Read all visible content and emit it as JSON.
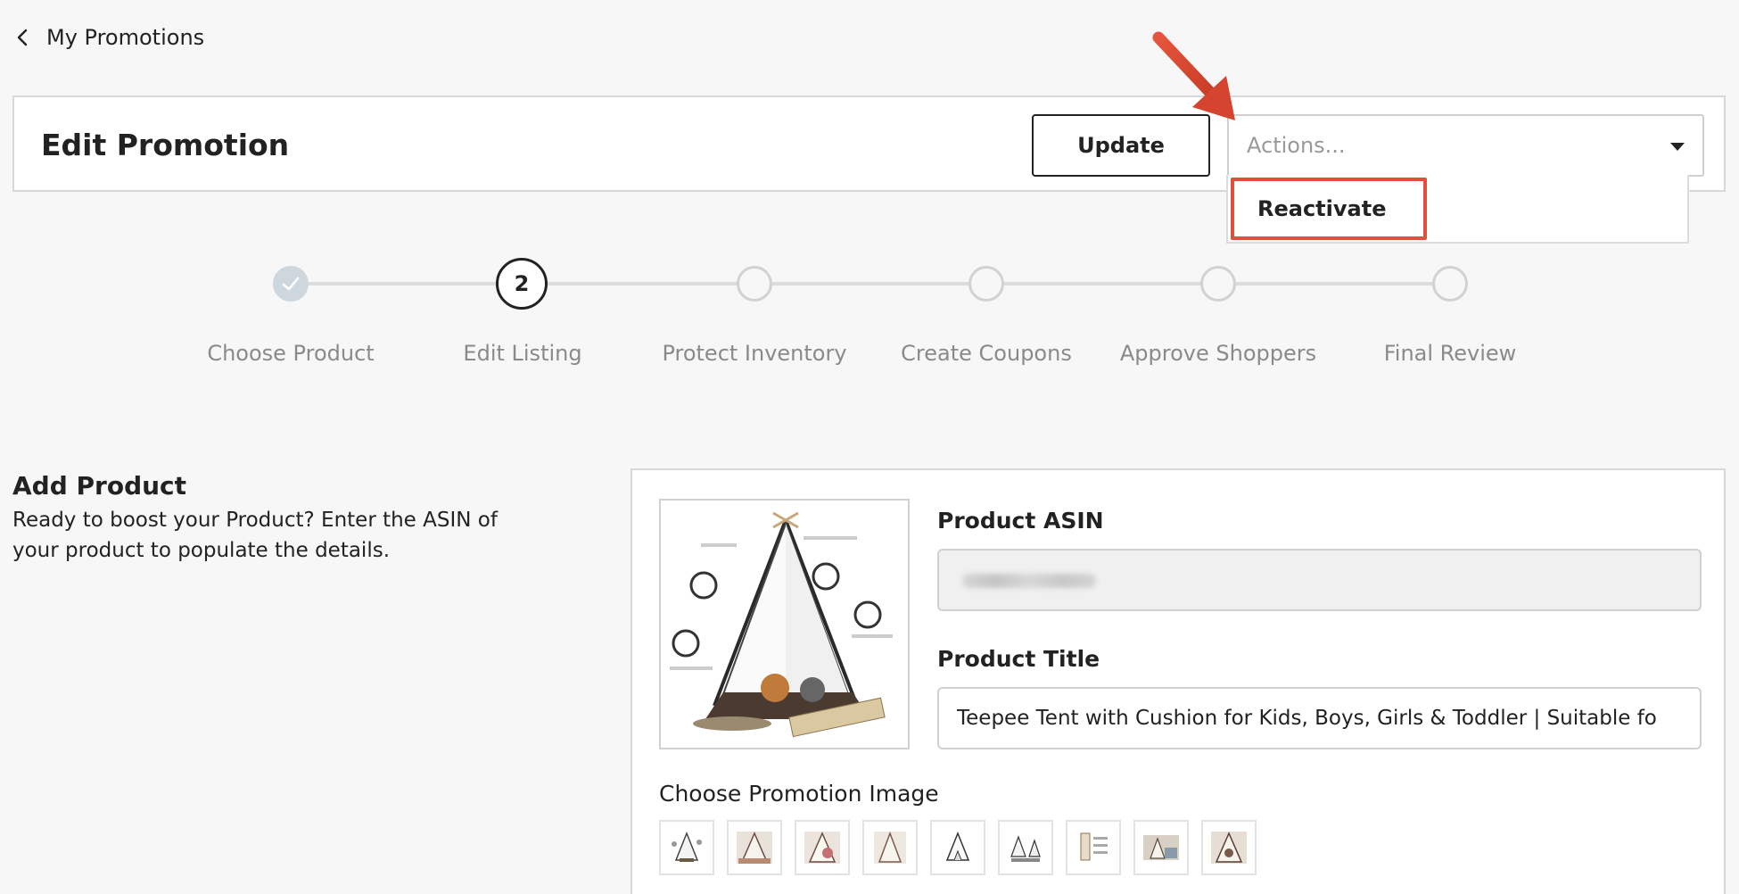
{
  "nav": {
    "back_label": "My Promotions"
  },
  "header": {
    "title": "Edit Promotion",
    "update_label": "Update",
    "actions_placeholder": "Actions...",
    "dropdown_items": [
      "Reactivate"
    ]
  },
  "stepper": {
    "current_step": 2,
    "steps": [
      {
        "label": "Choose Product",
        "state": "done"
      },
      {
        "label": "Edit Listing",
        "state": "active",
        "number": "2"
      },
      {
        "label": "Protect Inventory",
        "state": "upcoming"
      },
      {
        "label": "Create Coupons",
        "state": "upcoming"
      },
      {
        "label": "Approve Shoppers",
        "state": "upcoming"
      },
      {
        "label": "Final Review",
        "state": "upcoming"
      }
    ]
  },
  "add_product": {
    "title": "Add Product",
    "description": "Ready to boost your Product? Enter the ASIN of your product to populate the details."
  },
  "product_form": {
    "asin_label": "Product ASIN",
    "title_label": "Product Title",
    "title_value": "Teepee Tent with Cushion for Kids, Boys, Girls & Toddler | Suitable fo",
    "choose_image_label": "Choose Promotion Image",
    "thumbnail_count": 9
  },
  "colors": {
    "annotation_red": "#e0503a",
    "step_done": "#ced6de",
    "step_upcoming": "#d2d2d2",
    "text_dark": "#222222",
    "text_muted": "#8a8a8a"
  },
  "icons": {
    "back": "chevron-left-icon",
    "actions_caret": "caret-down-icon",
    "step_done": "check-icon"
  }
}
